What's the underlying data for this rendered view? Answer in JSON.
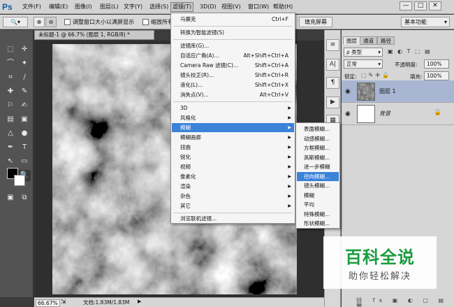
{
  "app": {
    "logo": "Ps",
    "menus": [
      "文件(F)",
      "编辑(E)",
      "图像(I)",
      "图层(L)",
      "文字(Y)",
      "选择(S)",
      "滤镜(T)",
      "3D(D)",
      "视图(V)",
      "窗口(W)",
      "帮助(H)"
    ],
    "active_menu_index": 6,
    "window_controls": [
      "—",
      "□",
      "✕"
    ]
  },
  "options_bar": {
    "zoom_checkbox_label": "调整窗口大小以满屏显示",
    "zoom_all_label": "缩放所有",
    "fill_screen_button": "填充屏幕",
    "workspace_select": "基本功能"
  },
  "document": {
    "tab_title": "未标题-1 @ 66.7% (图层 1, RGB/8) *",
    "zoom": "66.67%",
    "doc_size": "文档:1.83M/1.83M"
  },
  "filter_menu": {
    "items": [
      {
        "label": "马赛克",
        "shortcut": "Ctrl+F"
      },
      {
        "label": "转换为智能滤镜(S)",
        "shortcut": ""
      },
      {
        "label": "滤镜库(G)...",
        "shortcut": ""
      },
      {
        "label": "自适应广角(A)...",
        "shortcut": "Alt+Shift+Ctrl+A"
      },
      {
        "label": "Camera Raw 滤镜(C)...",
        "shortcut": "Shift+Ctrl+A"
      },
      {
        "label": "镜头校正(R)...",
        "shortcut": "Shift+Ctrl+R"
      },
      {
        "label": "液化(L)...",
        "shortcut": "Shift+Ctrl+X"
      },
      {
        "label": "消失点(V)...",
        "shortcut": "Alt+Ctrl+V"
      },
      {
        "label": "3D",
        "shortcut": ""
      },
      {
        "label": "风格化",
        "shortcut": ""
      },
      {
        "label": "模糊",
        "shortcut": ""
      },
      {
        "label": "模糊画廊",
        "shortcut": ""
      },
      {
        "label": "扭曲",
        "shortcut": ""
      },
      {
        "label": "锐化",
        "shortcut": ""
      },
      {
        "label": "视频",
        "shortcut": ""
      },
      {
        "label": "像素化",
        "shortcut": ""
      },
      {
        "label": "渲染",
        "shortcut": ""
      },
      {
        "label": "杂色",
        "shortcut": ""
      },
      {
        "label": "其它",
        "shortcut": ""
      },
      {
        "label": "浏览联机滤镜...",
        "shortcut": ""
      }
    ],
    "highlighted": "模糊"
  },
  "blur_submenu": {
    "items": [
      "表面模糊...",
      "动感模糊...",
      "方框模糊...",
      "高斯模糊...",
      "进一步模糊",
      "径向模糊...",
      "镜头模糊...",
      "模糊",
      "平均",
      "特殊模糊...",
      "形状模糊..."
    ],
    "highlighted": "径向模糊..."
  },
  "layers_panel": {
    "tabs": [
      "图层",
      "通道",
      "路径"
    ],
    "filter_kind": "ρ 类型",
    "blend_mode": "正常",
    "opacity_label": "不透明度:",
    "opacity_value": "100%",
    "lock_label": "锁定:",
    "fill_label": "填充:",
    "fill_value": "100%",
    "layers": [
      {
        "name": "图层 1"
      },
      {
        "name": "背景"
      }
    ]
  },
  "watermark": {
    "title": "百科全说",
    "subtitle": "助你轻松解决"
  },
  "colors": {
    "menu_highlight": "#3b82d9",
    "watermark_green": "#1a9c3e",
    "ps_blue": "#0d5ea8"
  }
}
